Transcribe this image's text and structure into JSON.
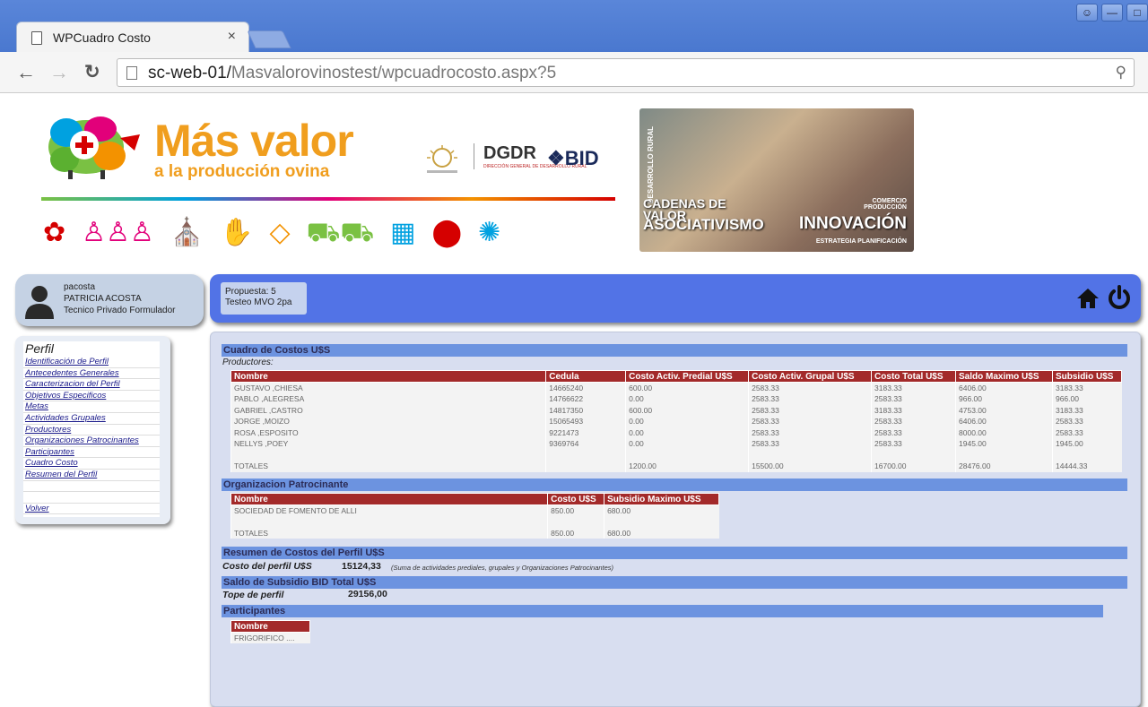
{
  "browser": {
    "tab_title": "WPCuadro Costo",
    "tab_close": "×",
    "url_host": "sc-web-01/",
    "url_path": "Masvalorovinostest/wpcuadrocosto.aspx?5"
  },
  "header": {
    "brand_main": "Más valor",
    "brand_sub": "a la producción ovina",
    "partner_dgdr": "DGDR",
    "partner_bid": "BID",
    "photo_texts": {
      "desarrollo_rural": "DESARROLLO RURAL",
      "cadenas": "CADENAS DE VALOR",
      "asociativismo": "ASOCIATIVISMO",
      "comercio": "COMERCIO PRODUCCIÓN",
      "innovacion": "INNOVACIÓN",
      "estrategia": "ESTRATEGIA PLANIFICACIÓN"
    }
  },
  "user": {
    "username": "pacosta",
    "full_name": "PATRICIA ACOSTA",
    "role": "Tecnico Privado Formulador"
  },
  "proposal": {
    "line1": "Propuesta: 5",
    "line2": "Testeo MVO 2pa"
  },
  "sidebar": {
    "title": "Perfil",
    "items": [
      {
        "label": "Identificación de Perfil"
      },
      {
        "label": "Antecedentes Generales"
      },
      {
        "label": "Caracterizacion del Perfil"
      },
      {
        "label": "Objetivos Especificos"
      },
      {
        "label": "Metas"
      },
      {
        "label": "Actividades Grupales"
      },
      {
        "label": "Productores"
      },
      {
        "label": "Organizaciones Patrocinantes"
      },
      {
        "label": "Participantes"
      },
      {
        "label": "Cuadro Costo"
      },
      {
        "label": "Resumen del Perfil"
      }
    ],
    "back": "Volver"
  },
  "cuadro": {
    "title": "Cuadro de Costos U$S",
    "productores_label": "Productores:",
    "headers": [
      "Nombre",
      "Cedula",
      "Costo Activ. Predial U$S",
      "Costo Activ. Grupal U$S",
      "Costo Total U$S",
      "Saldo Maximo U$S",
      "Subsidio U$S"
    ],
    "rows": [
      [
        "GUSTAVO ,CHIESA",
        "14665240",
        "600.00",
        "2583.33",
        "3183.33",
        "6406.00",
        "3183.33"
      ],
      [
        "PABLO ,ALEGRESA",
        "14766622",
        "0.00",
        "2583.33",
        "2583.33",
        "966.00",
        "966.00"
      ],
      [
        "GABRIEL ,CASTRO",
        "14817350",
        "600.00",
        "2583.33",
        "3183.33",
        "4753.00",
        "3183.33"
      ],
      [
        "JORGE ,MOIZO",
        "15065493",
        "0.00",
        "2583.33",
        "2583.33",
        "6406.00",
        "2583.33"
      ],
      [
        "ROSA ,ESPOSITO",
        "9221473",
        "0.00",
        "2583.33",
        "2583.33",
        "8000.00",
        "2583.33"
      ],
      [
        "NELLYS ,POEY",
        "9369764",
        "0.00",
        "2583.33",
        "2583.33",
        "1945.00",
        "1945.00"
      ]
    ],
    "totals": [
      "TOTALES",
      "",
      "1200.00",
      "15500.00",
      "16700.00",
      "28476.00",
      "14444.33"
    ]
  },
  "organizacion": {
    "title": "Organizacion Patrocinante",
    "headers": [
      "Nombre",
      "Costo U$S",
      "Subsidio Maximo U$S"
    ],
    "rows": [
      [
        "SOCIEDAD DE FOMENTO DE ALLI",
        "850.00",
        "680.00"
      ]
    ],
    "totals": [
      "TOTALES",
      "850.00",
      "680.00"
    ]
  },
  "resumen": {
    "title": "Resumen de Costos del Perfil U$S",
    "label": "Costo del perfil U$S",
    "value": "15124,33",
    "note": "(Suma de actividades prediales, grupales y Organizaciones Patrocinantes)"
  },
  "saldo": {
    "title": "Saldo de Subsidio BID Total U$S",
    "label": "Tope de perfil",
    "value": "29156,00"
  },
  "participantes": {
    "title": "Participantes",
    "headers": [
      "Nombre"
    ],
    "rows": [
      [
        "FRIGORIFICO ...."
      ]
    ]
  }
}
